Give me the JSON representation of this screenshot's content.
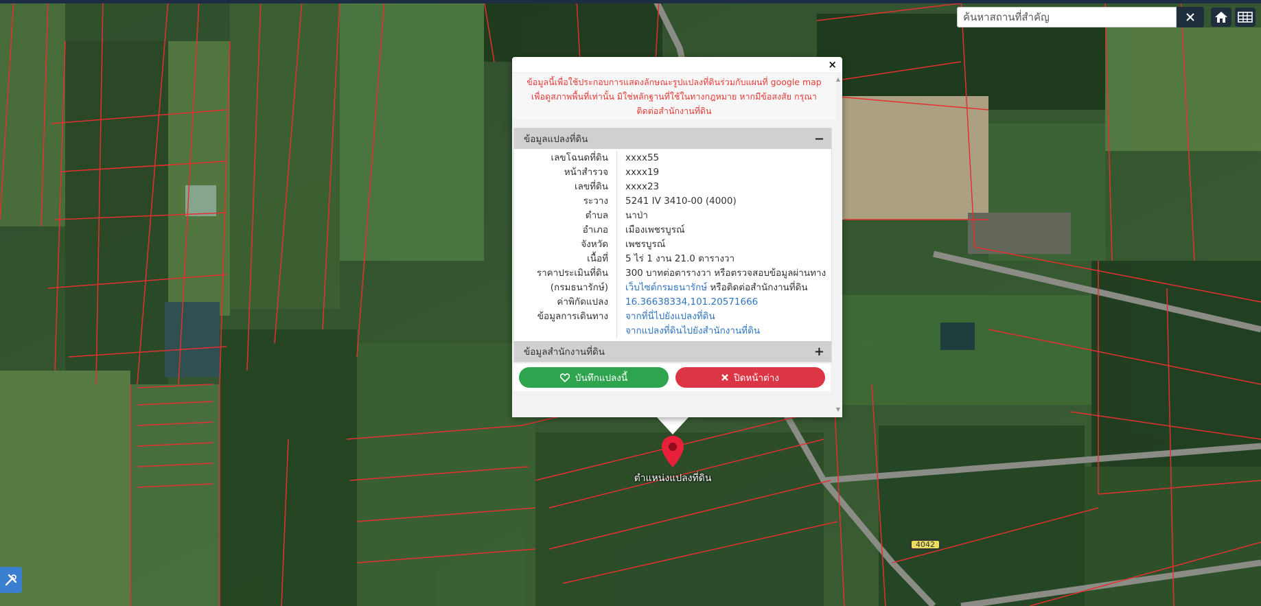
{
  "search": {
    "placeholder": "ค้นหาสถานที่สำคัญ",
    "value": ""
  },
  "icons": {
    "clear": "close-icon",
    "home": "home-icon",
    "grid": "grid-icon",
    "tool": "tools-icon",
    "marker": "map-pin-icon"
  },
  "map": {
    "marker_label": "ตำแหน่งแปลงที่ดิน",
    "road_sign": "4042",
    "boundary_color": "#e53030",
    "marker_color": "#e8213a"
  },
  "popup": {
    "disclaimer": [
      "ข้อมูลนี้เพื่อใช้ประกอบการแสดงลักษณะรูปแปลงที่ดินร่วมกับแผนที่ google map",
      "เพื่อดูสภาพพื้นที่เท่านั้น มิใช่หลักฐานที่ใช้ในทางกฎหมาย หากมีข้อสงสัย กรุณา",
      "ติดต่อสำนักงานที่ดิน"
    ],
    "section_parcel": {
      "title": "ข้อมูลแปลงที่ดิน",
      "toggle": "−",
      "rows": [
        {
          "label": "เลขโฉนดที่ดิน",
          "value": "xxxx55"
        },
        {
          "label": "หน้าสำรวจ",
          "value": "xxxx19"
        },
        {
          "label": "เลขที่ดิน",
          "value": "xxxx23"
        },
        {
          "label": "ระวาง",
          "value": "5241 IV 3410-00 (4000)"
        },
        {
          "label": "ตำบล",
          "value": "นาป่า"
        },
        {
          "label": "อำเภอ",
          "value": "เมืองเพชรบูรณ์"
        },
        {
          "label": "จังหวัด",
          "value": "เพชรบูรณ์"
        },
        {
          "label": "เนื้อที่",
          "value": "5 ไร่ 1 งาน 21.0 ตารางวา"
        }
      ],
      "price_label_1": "ราคาประเมินที่ดิน",
      "price_label_2": "(กรมธนารักษ์)",
      "price_value_1": "300 บาทต่อตารางวา หรือตรวจสอบข้อมูลผ่านทาง",
      "price_link": "เว็บไซต์กรมธนารักษ์",
      "price_value_2_rest": " หรือติดต่อสำนักงานที่ดิน",
      "coord_label": "ค่าพิกัดแปลง",
      "coord_value": "16.36638334,101.20571666",
      "travel_label": "ข้อมูลการเดินทาง",
      "travel_link_1": "จากที่นี่ไปยังแปลงที่ดิน",
      "travel_link_2": "จากแปลงที่ดินไปยังสำนักงานที่ดิน"
    },
    "section_office": {
      "title": "ข้อมูลสำนักงานที่ดิน",
      "toggle": "+"
    },
    "buttons": {
      "save": "บันทึกแปลงนี้",
      "close": "ปิดหน้าต่าง"
    },
    "close_x": "×"
  }
}
